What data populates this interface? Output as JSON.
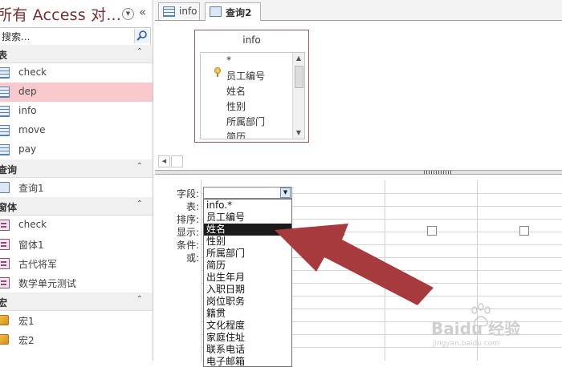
{
  "nav": {
    "title": "所有 Access 对...",
    "search_placeholder": "搜索...",
    "groups": [
      {
        "title": "表",
        "items": [
          {
            "label": "check",
            "icon": "table-icon",
            "selected": false
          },
          {
            "label": "dep",
            "icon": "table-icon",
            "selected": true
          },
          {
            "label": "info",
            "icon": "table-icon",
            "selected": false
          },
          {
            "label": "move",
            "icon": "table-icon",
            "selected": false
          },
          {
            "label": "pay",
            "icon": "table-icon",
            "selected": false
          }
        ]
      },
      {
        "title": "查询",
        "items": [
          {
            "label": "查询1",
            "icon": "query-icon",
            "selected": false
          }
        ]
      },
      {
        "title": "窗体",
        "items": [
          {
            "label": "check",
            "icon": "form-icon",
            "selected": false
          },
          {
            "label": "窗体1",
            "icon": "form-icon",
            "selected": false
          },
          {
            "label": "古代将军",
            "icon": "form-icon",
            "selected": false
          },
          {
            "label": "数学单元测试",
            "icon": "form-icon",
            "selected": false
          }
        ]
      },
      {
        "title": "宏",
        "items": [
          {
            "label": "宏1",
            "icon": "macro-icon",
            "selected": false
          },
          {
            "label": "宏2",
            "icon": "macro-icon",
            "selected": false
          }
        ]
      }
    ]
  },
  "tabs": [
    {
      "label": "info",
      "active": false
    },
    {
      "label": "查询2",
      "active": true
    }
  ],
  "table_box": {
    "title": "info",
    "fields": [
      "*",
      "员工编号",
      "姓名",
      "性别",
      "所属部门",
      "简历"
    ]
  },
  "qbe": {
    "row_labels": [
      "字段:",
      "表:",
      "排序:",
      "显示:",
      "条件:",
      "或:"
    ],
    "field_dropdown_items": [
      "info.*",
      "员工编号",
      "姓名",
      "性别",
      "所属部门",
      "简历",
      "出生年月",
      "入职日期",
      "岗位职务",
      "籍贯",
      "文化程度",
      "家庭住址",
      "联系电话",
      "电子邮箱"
    ],
    "selected_item": "姓名"
  },
  "colors": {
    "selected_nav_bg": "#f9c9cc",
    "arrow": "#a63a3d",
    "title_text": "#7a2e2e"
  },
  "watermark": {
    "text": "Baidu 经验",
    "url_text": "jingyan.baidu.com"
  }
}
